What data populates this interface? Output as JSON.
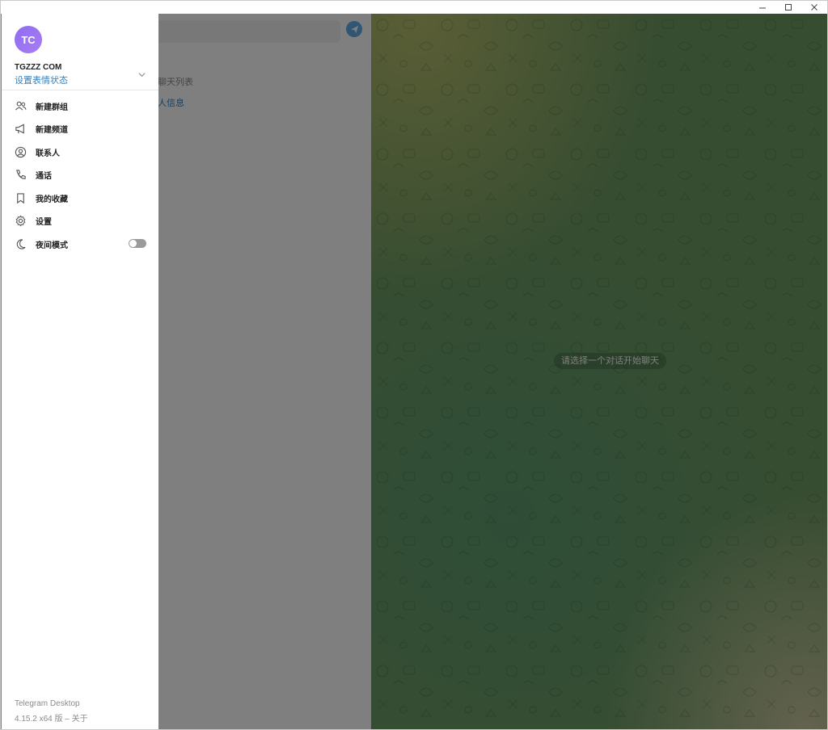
{
  "window": {
    "controls": {
      "minimize_icon": "minimize-icon",
      "maximize_icon": "maximize-icon",
      "close_icon": "close-icon"
    }
  },
  "chat_list": {
    "empty_text": "此是您的聊天列表",
    "empty_link": "新建联系人信息",
    "compose_icon": "paper-plane-icon"
  },
  "chat_area": {
    "select_prompt": "请选择一个对话开始聊天"
  },
  "side_menu": {
    "avatar_initials": "TC",
    "profile_name": "TGZZZ COM",
    "profile_status": "设置表情状态",
    "items": [
      {
        "label": "新建群组",
        "icon": "users-icon"
      },
      {
        "label": "新建频道",
        "icon": "megaphone-icon"
      },
      {
        "label": "联系人",
        "icon": "contact-icon"
      },
      {
        "label": "通话",
        "icon": "phone-icon"
      },
      {
        "label": "我的收藏",
        "icon": "bookmark-icon"
      },
      {
        "label": "设置",
        "icon": "gear-icon"
      },
      {
        "label": "夜间模式",
        "icon": "moon-icon",
        "toggle": false
      }
    ],
    "app_name": "Telegram Desktop",
    "app_version": "4.15.2 x64 版 – 关于"
  },
  "colors": {
    "accent": "#2c83c6",
    "avatar": "#9a73f1",
    "chat_bg": "#6f9a62"
  }
}
